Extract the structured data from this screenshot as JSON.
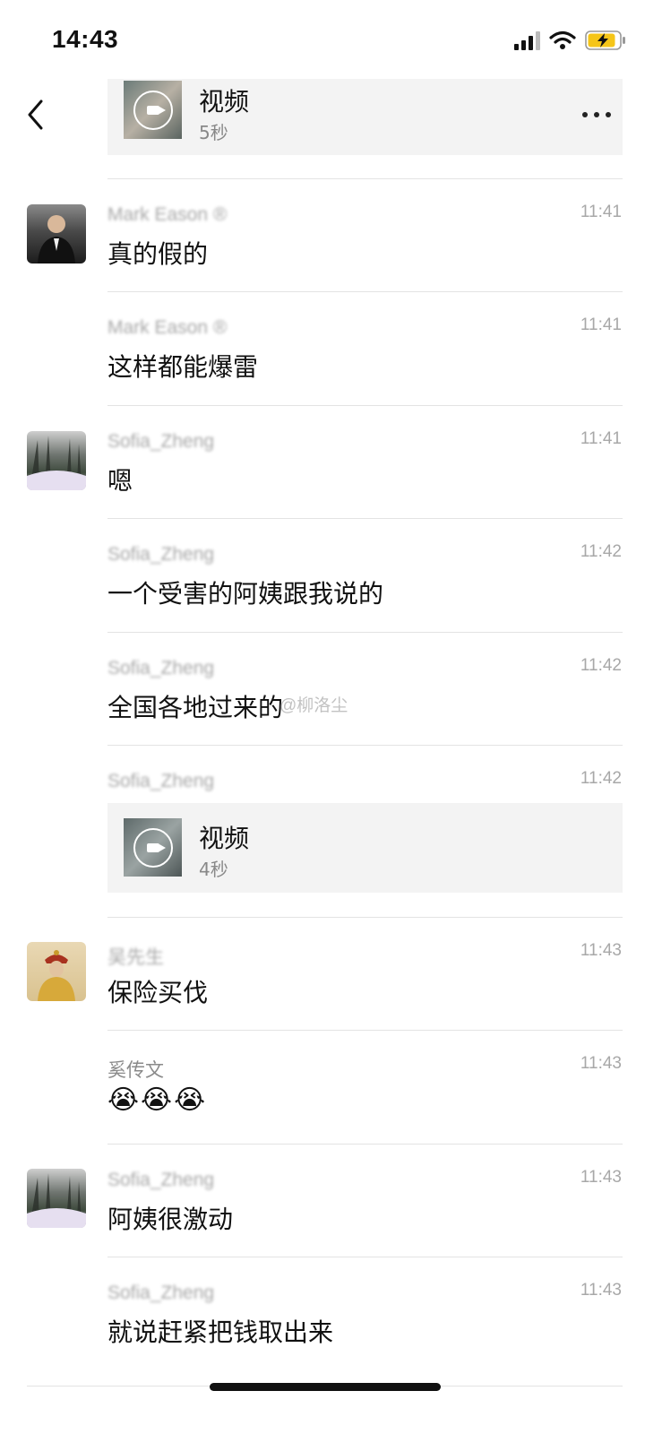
{
  "status_bar": {
    "time": "14:43",
    "signal_icon": "cellular-signal-icon",
    "wifi_icon": "wifi-icon",
    "battery_icon": "battery-charging-icon"
  },
  "header": {
    "back_icon": "chevron-left-icon",
    "more_icon": "more-dots-icon"
  },
  "top_video": {
    "title": "视频",
    "duration": "5秒"
  },
  "messages": [
    {
      "sender": "Mark Eason ®",
      "time": "11:41",
      "text": "真的假的"
    },
    {
      "sender": "Mark Eason ®",
      "time": "11:41",
      "text": "这样都能爆雷"
    },
    {
      "sender": "Sofia_Zheng",
      "time": "11:41",
      "text": "嗯"
    },
    {
      "sender": "Sofia_Zheng",
      "time": "11:42",
      "text": "一个受害的阿姨跟我说的"
    },
    {
      "sender": "Sofia_Zheng",
      "time": "11:42",
      "text": "全国各地过来的"
    },
    {
      "sender": "Sofia_Zheng",
      "time": "11:42",
      "video_title": "视频",
      "video_duration": "4秒"
    },
    {
      "sender": "吴先生",
      "time": "11:43",
      "text": "保险买伐"
    },
    {
      "sender": "奚传文",
      "time": "11:43",
      "text": "😭😭😭"
    },
    {
      "sender": "Sofia_Zheng",
      "time": "11:43",
      "text": "阿姨很激动"
    },
    {
      "sender": "Sofia_Zheng",
      "time": "11:43",
      "text": "就说赶紧把钱取出来"
    }
  ],
  "watermark": "@柳洛尘"
}
